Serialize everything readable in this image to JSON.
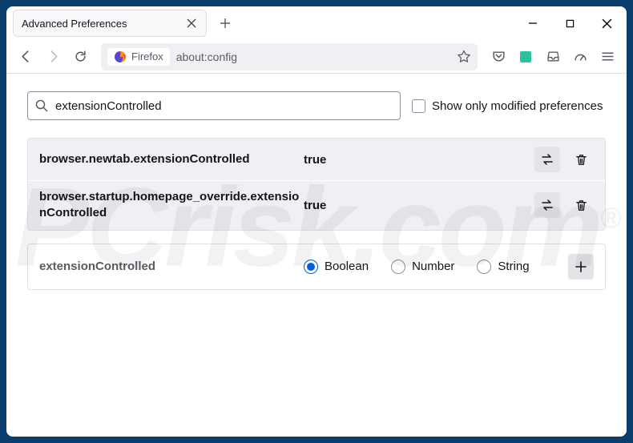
{
  "tab": {
    "title": "Advanced Preferences"
  },
  "address": {
    "chip": "Firefox",
    "url": "about:config"
  },
  "search": {
    "value": "extensionControlled",
    "show_modified_label": "Show only modified preferences"
  },
  "prefs": [
    {
      "name": "browser.newtab.extensionControlled",
      "value": "true"
    },
    {
      "name": "browser.startup.homepage_override.extensionControlled",
      "value": "true"
    }
  ],
  "newpref": {
    "name": "extensionControlled",
    "types": {
      "boolean": "Boolean",
      "number": "Number",
      "string": "String"
    },
    "selected": "boolean"
  },
  "watermark": {
    "text": "PCrisk.com",
    "reg": "®"
  }
}
